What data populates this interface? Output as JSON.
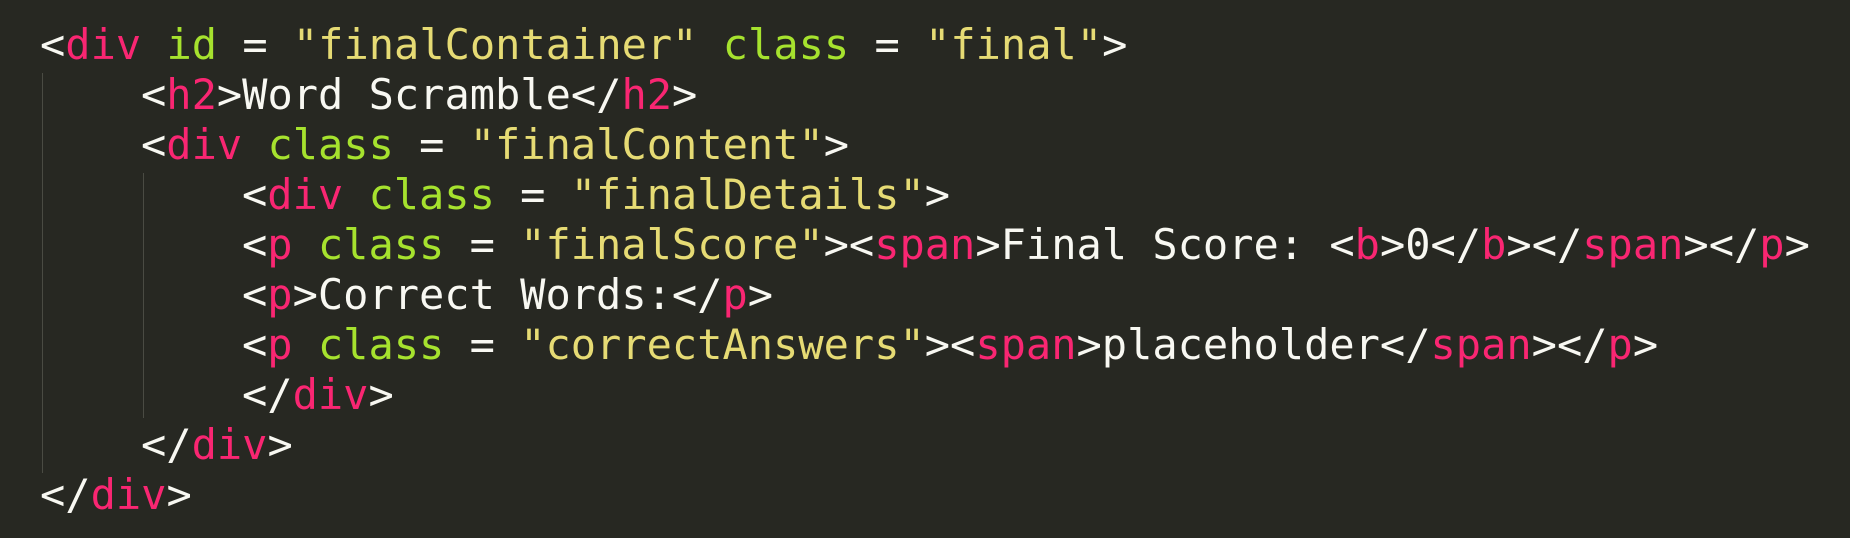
{
  "editor": {
    "theme_colors": {
      "background": "#272822",
      "text": "#f8f8f2",
      "tag": "#f92672",
      "attribute": "#a6e22e",
      "string": "#e6db74"
    },
    "lines": [
      [
        {
          "t": "p",
          "v": "<"
        },
        {
          "t": "tag",
          "v": "div"
        },
        {
          "t": "p",
          "v": " "
        },
        {
          "t": "attr",
          "v": "id"
        },
        {
          "t": "p",
          "v": " = "
        },
        {
          "t": "str",
          "v": "\"finalContainer\""
        },
        {
          "t": "p",
          "v": " "
        },
        {
          "t": "attr",
          "v": "class"
        },
        {
          "t": "p",
          "v": " = "
        },
        {
          "t": "str",
          "v": "\"final\""
        },
        {
          "t": "p",
          "v": ">"
        }
      ],
      [
        {
          "t": "p",
          "v": "<"
        },
        {
          "t": "tag",
          "v": "h2"
        },
        {
          "t": "p",
          "v": ">Word Scramble</"
        },
        {
          "t": "tag",
          "v": "h2"
        },
        {
          "t": "p",
          "v": ">"
        }
      ],
      [
        {
          "t": "p",
          "v": "<"
        },
        {
          "t": "tag",
          "v": "div"
        },
        {
          "t": "p",
          "v": " "
        },
        {
          "t": "attr",
          "v": "class"
        },
        {
          "t": "p",
          "v": " = "
        },
        {
          "t": "str",
          "v": "\"finalContent\""
        },
        {
          "t": "p",
          "v": ">"
        }
      ],
      [
        {
          "t": "p",
          "v": "<"
        },
        {
          "t": "tag",
          "v": "div"
        },
        {
          "t": "p",
          "v": " "
        },
        {
          "t": "attr",
          "v": "class"
        },
        {
          "t": "p",
          "v": " = "
        },
        {
          "t": "str",
          "v": "\"finalDetails\""
        },
        {
          "t": "p",
          "v": ">"
        }
      ],
      [
        {
          "t": "p",
          "v": "<"
        },
        {
          "t": "tag",
          "v": "p"
        },
        {
          "t": "p",
          "v": " "
        },
        {
          "t": "attr",
          "v": "class"
        },
        {
          "t": "p",
          "v": " = "
        },
        {
          "t": "str",
          "v": "\"finalScore\""
        },
        {
          "t": "p",
          "v": "><"
        },
        {
          "t": "tag",
          "v": "span"
        },
        {
          "t": "p",
          "v": ">Final Score: <"
        },
        {
          "t": "tag",
          "v": "b"
        },
        {
          "t": "p",
          "v": ">0</"
        },
        {
          "t": "tag",
          "v": "b"
        },
        {
          "t": "p",
          "v": "></"
        },
        {
          "t": "tag",
          "v": "span"
        },
        {
          "t": "p",
          "v": "></"
        },
        {
          "t": "tag",
          "v": "p"
        },
        {
          "t": "p",
          "v": ">"
        }
      ],
      [
        {
          "t": "p",
          "v": "<"
        },
        {
          "t": "tag",
          "v": "p"
        },
        {
          "t": "p",
          "v": ">Correct Words:</"
        },
        {
          "t": "tag",
          "v": "p"
        },
        {
          "t": "p",
          "v": ">"
        }
      ],
      [
        {
          "t": "p",
          "v": "<"
        },
        {
          "t": "tag",
          "v": "p"
        },
        {
          "t": "p",
          "v": " "
        },
        {
          "t": "attr",
          "v": "class"
        },
        {
          "t": "p",
          "v": " = "
        },
        {
          "t": "str",
          "v": "\"correctAnswers\""
        },
        {
          "t": "p",
          "v": "><"
        },
        {
          "t": "tag",
          "v": "span"
        },
        {
          "t": "p",
          "v": ">placeholder</"
        },
        {
          "t": "tag",
          "v": "span"
        },
        {
          "t": "p",
          "v": "></"
        },
        {
          "t": "tag",
          "v": "p"
        },
        {
          "t": "p",
          "v": ">"
        }
      ],
      [
        {
          "t": "p",
          "v": "</"
        },
        {
          "t": "tag",
          "v": "div"
        },
        {
          "t": "p",
          "v": ">"
        }
      ],
      [
        {
          "t": "p",
          "v": "</"
        },
        {
          "t": "tag",
          "v": "div"
        },
        {
          "t": "p",
          "v": ">"
        }
      ],
      [
        {
          "t": "p",
          "v": "</"
        },
        {
          "t": "tag",
          "v": "div"
        },
        {
          "t": "p",
          "v": ">"
        }
      ]
    ]
  }
}
